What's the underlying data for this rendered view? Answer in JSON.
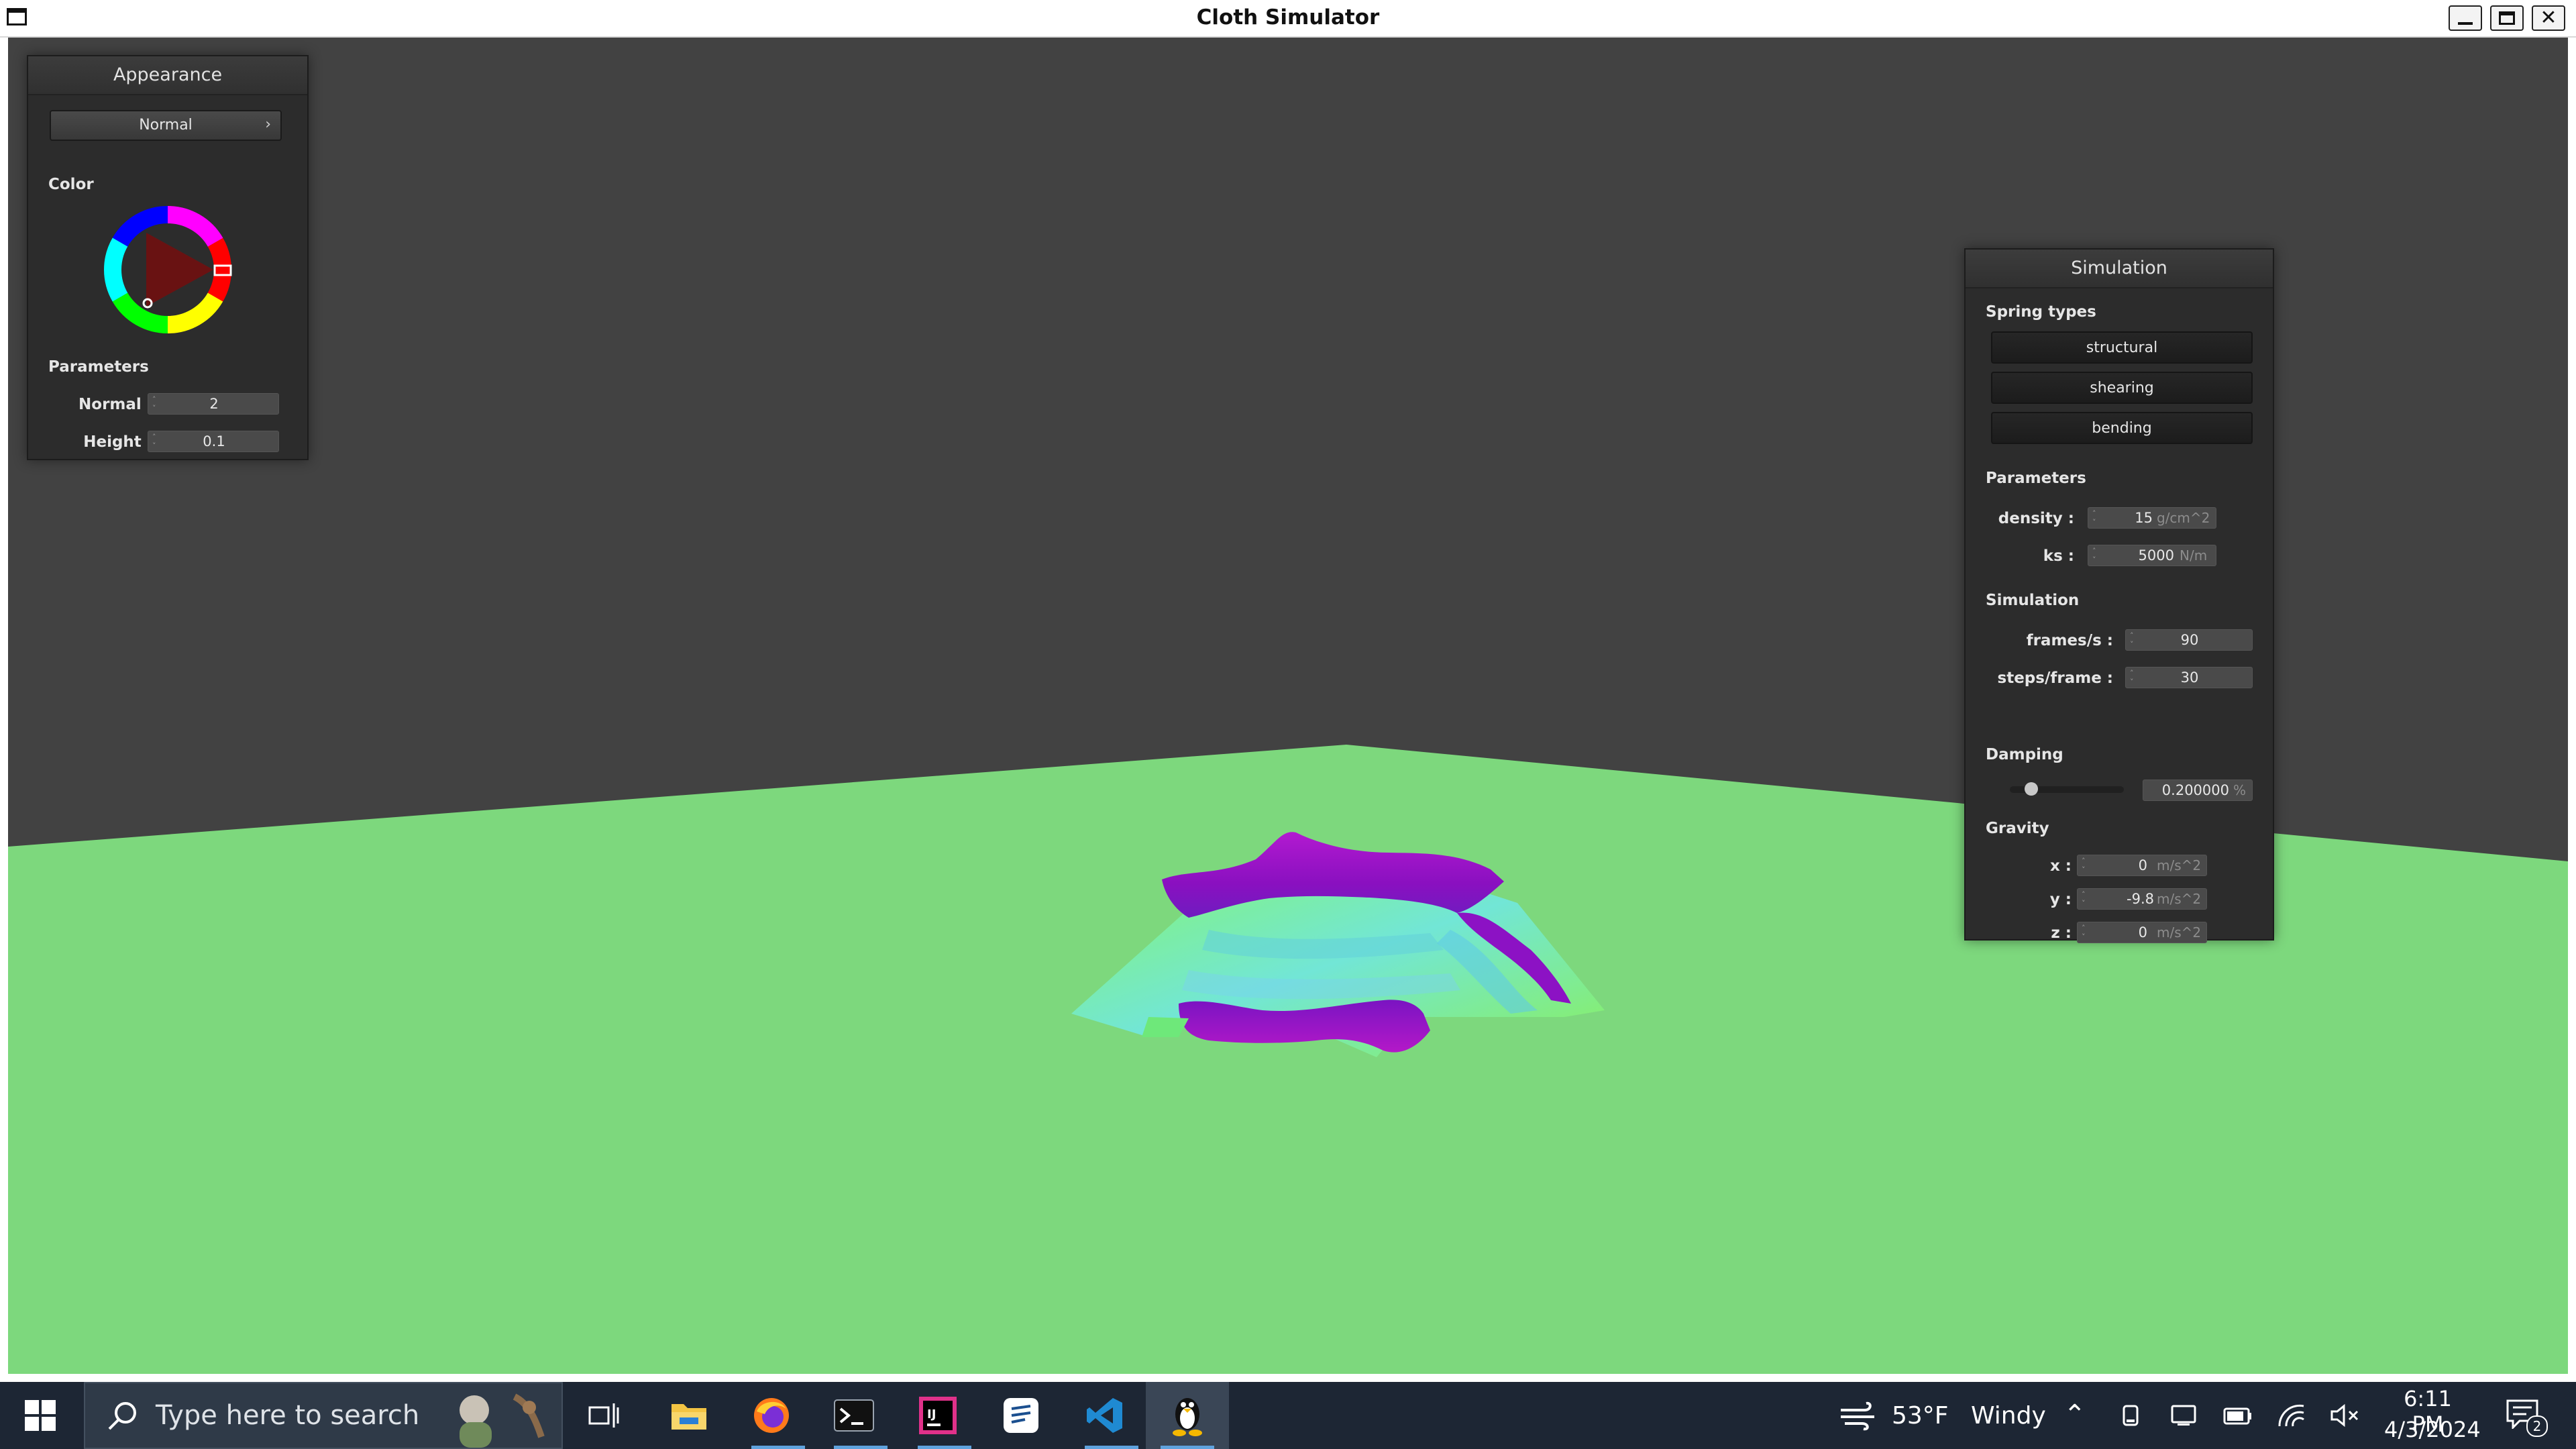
{
  "window": {
    "title": "Cloth Simulator"
  },
  "appearance_panel": {
    "title": "Appearance",
    "mode_select": {
      "value": "Normal",
      "arrow": "›"
    },
    "color_label": "Color",
    "parameters_label": "Parameters",
    "normal": {
      "label": "Normal :",
      "value": "2"
    },
    "height": {
      "label": "Height :",
      "value": "0.1"
    }
  },
  "simulation_panel": {
    "title": "Simulation",
    "spring_types_label": "Spring types",
    "spring_buttons": [
      "structural",
      "shearing",
      "bending"
    ],
    "parameters_label": "Parameters",
    "density": {
      "label": "density :",
      "value": "15",
      "unit": "g/cm^2"
    },
    "ks": {
      "label": "ks :",
      "value": "5000",
      "unit": "N/m"
    },
    "simulation_label": "Simulation",
    "frames": {
      "label": "frames/s :",
      "value": "90"
    },
    "steps": {
      "label": "steps/frame :",
      "value": "30"
    },
    "damping_label": "Damping",
    "damping": {
      "value": "0.200000",
      "unit": "%",
      "slider_fraction": 0.2
    },
    "gravity_label": "Gravity",
    "gravity_x": {
      "label": "x :",
      "value": "0",
      "unit": "m/s^2"
    },
    "gravity_y": {
      "label": "y :",
      "value": "-9.8",
      "unit": "m/s^2"
    },
    "gravity_z": {
      "label": "z :",
      "value": "0",
      "unit": "m/s^2"
    }
  },
  "colors": {
    "background": "#424242",
    "floor": "#7dd87d",
    "cloth_high": "#9a10c8",
    "cloth_low": "#7cf06a",
    "cloth_mid": "#70d8e8"
  },
  "taskbar": {
    "search_placeholder": "Type here to search",
    "apps": [
      "start-icon",
      "task-view-icon",
      "file-explorer-icon",
      "firefox-icon",
      "terminal-icon",
      "intellij-icon",
      "notes-icon",
      "vscode-icon",
      "linux-penguin-icon"
    ],
    "weather": {
      "temp": "53°F",
      "condition": "Windy"
    },
    "time": "6:11 PM",
    "date": "4/3/2024",
    "notification_count": "2"
  }
}
